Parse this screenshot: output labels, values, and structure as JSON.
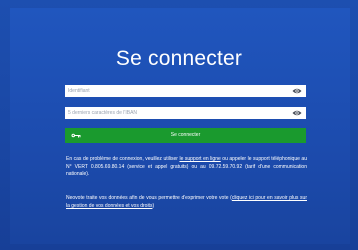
{
  "login": {
    "title": "Se connecter",
    "identifier_placeholder": "Identifiant",
    "iban_placeholder": "5 derniers caractères de l'IBAN",
    "submit_label": "Se connecter"
  },
  "help": {
    "text_before": "En cas de problème de connexion, veuillez utiliser ",
    "support_link": "le support en ligne",
    "text_after": " ou appeler le support téléphonique au N° VERT 0.805.69.80.14 (service et appel gratuits) ou au 09.72.59.70.92 (tarif d'une communication nationale)."
  },
  "privacy": {
    "text_before": "Neovote traite vos données afin de vous permettre d'exprimer votre vote (",
    "link": "cliquez ici pour en savoir plus sur la gestion de vos données et vos droits",
    "text_after": ")"
  },
  "colors": {
    "background": "#1c4bad",
    "button": "#1a9a2e",
    "text": "#ffffff"
  },
  "icons": {
    "reveal": "eye-icon",
    "submit": "key-icon"
  }
}
